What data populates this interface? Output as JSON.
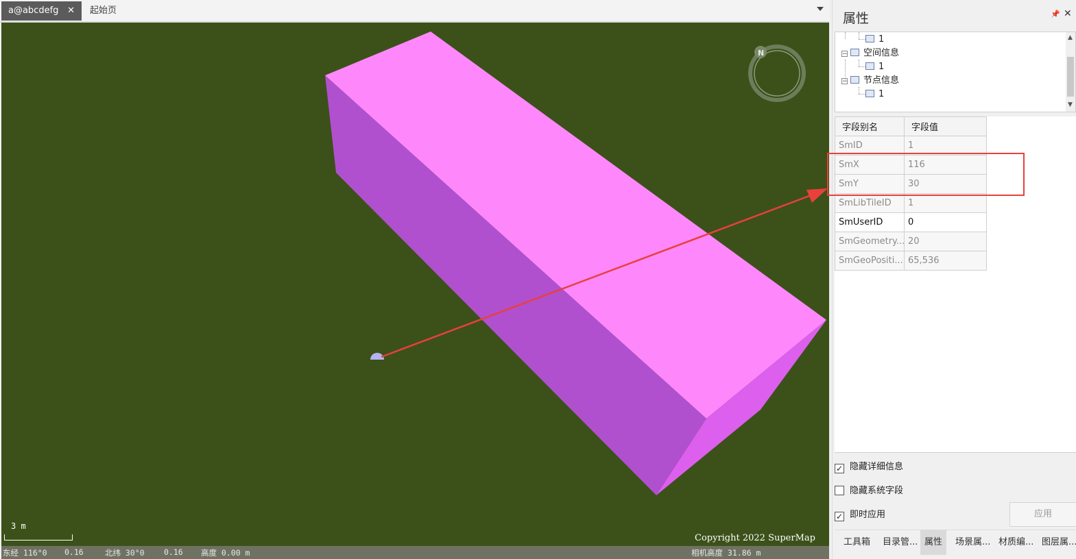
{
  "doc_tabs": [
    {
      "label": "a@abcdefg",
      "close": "✕",
      "active": true
    },
    {
      "label": "起始页",
      "active": false
    }
  ],
  "scene": {
    "background_color": "#3b5119",
    "box_colors": {
      "top": "#fe88fb",
      "front": "#b050cf",
      "end": "#dd5fee"
    },
    "scale_label": "3 m",
    "copyright": "Copyright 2022 SuperMap",
    "compass_letter": "N",
    "status": {
      "lon_label": "东经 116°0",
      "lon_value": "0.16",
      "lat_label": "北纬 30°0",
      "lat_value": "0.16",
      "alt_label": "高度 0.00 m",
      "camera_label": "相机高度 31.86 m"
    }
  },
  "panel": {
    "title": "属性",
    "pin_icon": "pin-icon",
    "close_icon": "close-icon",
    "tree": [
      {
        "label": "1",
        "level": 1
      },
      {
        "label": "空间信息",
        "level": 0,
        "expand": "−"
      },
      {
        "label": "1",
        "level": 1
      },
      {
        "label": "节点信息",
        "level": 0,
        "expand": "−"
      },
      {
        "label": "1",
        "level": 1
      }
    ],
    "table": {
      "headers": [
        "字段别名",
        "字段值"
      ],
      "rows": [
        {
          "name": "SmID",
          "value": "1",
          "editable": false
        },
        {
          "name": "SmX",
          "value": "116",
          "editable": false
        },
        {
          "name": "SmY",
          "value": "30",
          "editable": false
        },
        {
          "name": "SmLibTileID",
          "value": "1",
          "editable": false
        },
        {
          "name": "SmUserID",
          "value": "0",
          "editable": true
        },
        {
          "name": "SmGeometry...",
          "value": "20",
          "editable": false
        },
        {
          "name": "SmGeoPositi...",
          "value": "65,536",
          "editable": false
        }
      ]
    },
    "options": [
      {
        "label": "隐藏详细信息",
        "checked": true
      },
      {
        "label": "隐藏系统字段",
        "checked": false
      },
      {
        "label": "即时应用",
        "checked": true
      }
    ],
    "apply_label": "应用",
    "bottom_tabs": [
      {
        "label": "工具箱",
        "active": false
      },
      {
        "label": "目录管...",
        "active": false
      },
      {
        "label": "属性",
        "active": true
      },
      {
        "label": "场景属...",
        "active": false
      },
      {
        "label": "材质编...",
        "active": false
      },
      {
        "label": "图层属...",
        "active": false
      }
    ]
  },
  "annotation_color": "#e8403c"
}
